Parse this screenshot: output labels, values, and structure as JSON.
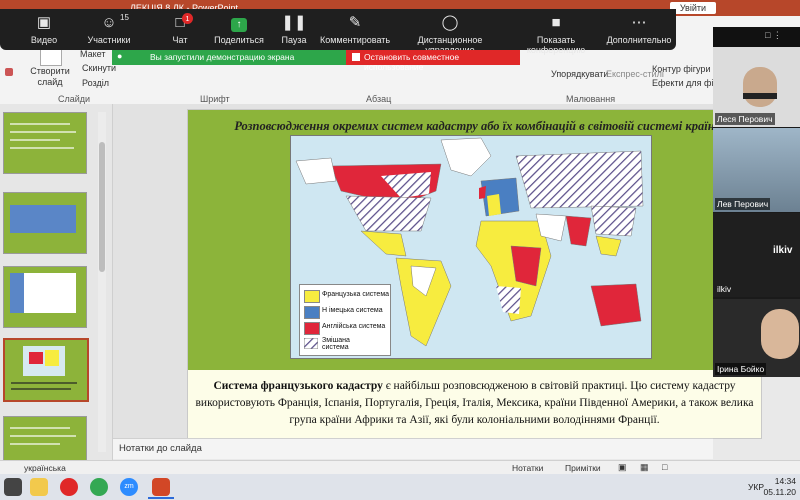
{
  "powerpoint": {
    "title_fragment": "ЛЕКЦІЯ 8 ЛК - PowerPoint",
    "sign_in": "Увійти",
    "ribbon": {
      "new_slide": "Створити слайд",
      "layout": "Макет",
      "reset": "Скинути",
      "section": "Розділ",
      "groups": {
        "slides": "Слайди",
        "font": "Шрифт",
        "paragraph": "Абзац",
        "drawing": "Малювання"
      },
      "arrange": "Упорядкувати",
      "quick_styles": "Експрес-стилі",
      "shape_outline": "Контур фігури",
      "shape_effects": "Ефекти для фігур"
    }
  },
  "zoom_toolbar": {
    "items": [
      {
        "label": "Видео",
        "icon": "video-camera-icon"
      },
      {
        "label": "Участники",
        "icon": "participants-icon",
        "count": "15"
      },
      {
        "label": "Чат",
        "icon": "chat-icon",
        "badge": "1"
      },
      {
        "label": "Поделиться",
        "icon": "share-screen-icon"
      },
      {
        "label": "Пауза",
        "icon": "pause-icon"
      },
      {
        "label": "Комментировать",
        "icon": "annotate-pen-icon"
      },
      {
        "label": "Дистанционное управление",
        "icon": "remote-control-icon"
      },
      {
        "label": "Показать конференцию",
        "icon": "show-meeting-icon"
      },
      {
        "label": "Дополнительно",
        "icon": "more-icon"
      }
    ],
    "sharing_notice": "Вы запустили демонстрацию экрана",
    "stop_share": "Остановить совместное использование"
  },
  "slide": {
    "title": "Розповсюдження окремих систем кадастру або їх комбінацій в світовій системі країн",
    "legend": [
      "Французька система",
      "Н імецька система",
      "Англійська система",
      "Змішана система"
    ],
    "legend_colors": {
      "french": "#f7ec3f",
      "german": "#4a7fc2",
      "english": "#e0263a",
      "mixed": "hatch"
    },
    "body_bold": "Система французького кадастру",
    "body_rest": " є найбільш розповсюдженою в світовій практиці. Цю систему кадастру використовують Франція, Іспанія, Португалія, Греція, Італія, Мексика, країни Південної Америки, а також велика група країни Африки та Азії, які були колоніальними володіннями Франції."
  },
  "notes_placeholder": "Нотатки до слайда",
  "participants": [
    {
      "name": "Леся Перович"
    },
    {
      "name": "Лев Перович"
    },
    {
      "name": "ilkiv",
      "big_label": "ilkiv"
    },
    {
      "name": "Ірина Бойко"
    }
  ],
  "status_bar": {
    "language": "українська",
    "notes": "Нотатки",
    "comments": "Примітки"
  },
  "taskbar": {
    "time": "14:34",
    "date": "05.11.20",
    "lang": "УКР"
  }
}
